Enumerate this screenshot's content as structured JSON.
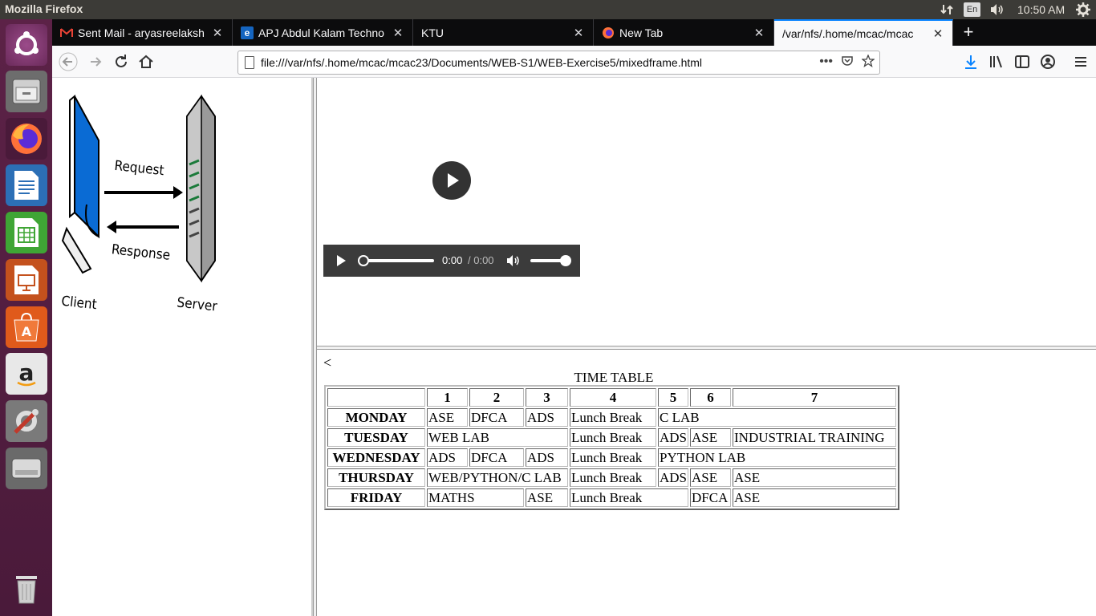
{
  "system": {
    "app_title": "Mozilla Firefox",
    "lang": "En",
    "clock": "10:50 AM"
  },
  "launcher": {
    "items": [
      "Ubuntu",
      "Files",
      "Firefox",
      "Writer",
      "Calc",
      "Impress",
      "Software Center",
      "Amazon",
      "System Settings",
      "Drive",
      "Trash"
    ]
  },
  "tabs": [
    {
      "label": "Sent Mail - aryasreelaksh",
      "icon": "gmail-icon"
    },
    {
      "label": "APJ Abdul Kalam Techno",
      "icon": "ie-icon"
    },
    {
      "label": "KTU",
      "icon": ""
    },
    {
      "label": "New Tab",
      "icon": "firefox-icon"
    },
    {
      "label": "/var/nfs/.home/mcac/mcac",
      "icon": "",
      "active": true
    }
  ],
  "navbar": {
    "url": "file:///var/nfs/.home/mcac/mcac23/Documents/WEB-S1/WEB-Exercise5/mixedframe.html"
  },
  "left_frame": {
    "diagram": {
      "request_label": "Request",
      "response_label": "Response",
      "client_label": "Client",
      "server_label": "Server"
    }
  },
  "audio": {
    "time": "0:00",
    "duration": "/ 0:00",
    "progress": 0,
    "volume": 1.0
  },
  "timetable": {
    "lt_char": "<",
    "title": "TIME TABLE",
    "headers": [
      "",
      "1",
      "2",
      "3",
      "4",
      "5",
      "6",
      "7"
    ],
    "rows": [
      {
        "day": "MONDAY",
        "cells": [
          "ASE",
          "DFCA",
          "ADS",
          "Lunch Break",
          "C LAB"
        ]
      },
      {
        "day": "TUESDAY",
        "cells": [
          "WEB LAB",
          "Lunch Break",
          "ADS",
          "ASE",
          "INDUSTRIAL TRAINING"
        ]
      },
      {
        "day": "WEDNESDAY",
        "cells": [
          "ADS",
          "DFCA",
          "ADS",
          "Lunch Break",
          "PYTHON LAB"
        ]
      },
      {
        "day": "THURSDAY",
        "cells": [
          "WEB/PYTHON/C LAB",
          "Lunch Break",
          "ADS",
          "ASE",
          "ASE"
        ]
      },
      {
        "day": "FRIDAY",
        "cells": [
          "MATHS",
          "ASE",
          "Lunch Break",
          "DFCA",
          "ASE"
        ]
      }
    ]
  }
}
